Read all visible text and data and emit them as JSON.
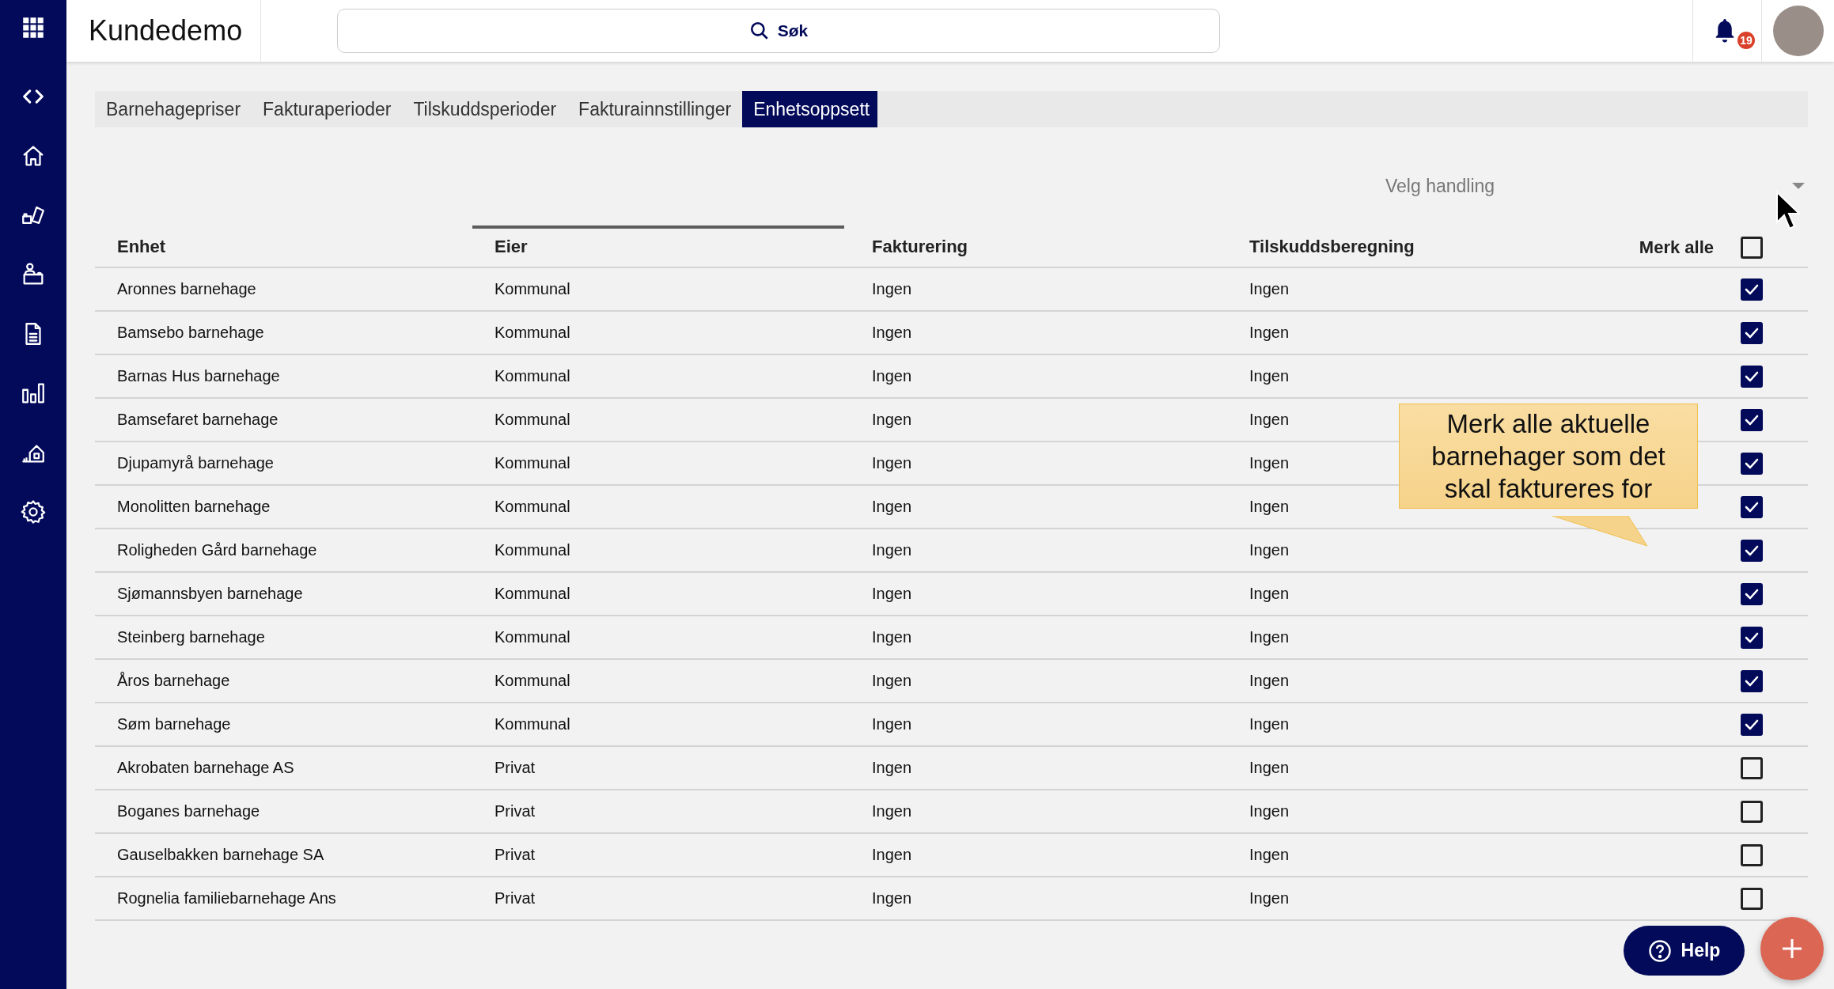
{
  "topbar": {
    "title": "Kundedemo",
    "search": {
      "placeholder": "Søk"
    },
    "notifications": {
      "count": "19"
    }
  },
  "tabs": [
    {
      "label": "Barnehagepriser",
      "selected": false
    },
    {
      "label": "Fakturaperioder",
      "selected": false
    },
    {
      "label": "Tilskuddsperioder",
      "selected": false
    },
    {
      "label": "Fakturainnstillinger",
      "selected": false
    },
    {
      "label": "Enhetsoppsett",
      "selected": true
    }
  ],
  "action_select": {
    "placeholder": "Velg handling"
  },
  "table": {
    "columns": [
      {
        "label": "Enhet",
        "sorted": false
      },
      {
        "label": "Eier",
        "sorted": true
      },
      {
        "label": "Fakturering",
        "sorted": false
      },
      {
        "label": "Tilskuddsberegning",
        "sorted": false
      }
    ],
    "select_all": {
      "label": "Merk alle",
      "checked": false
    },
    "rows": [
      {
        "unit": "Aronnes barnehage",
        "owner": "Kommunal",
        "invoicing": "Ingen",
        "subsidy": "Ingen",
        "checked": true
      },
      {
        "unit": "Bamsebo barnehage",
        "owner": "Kommunal",
        "invoicing": "Ingen",
        "subsidy": "Ingen",
        "checked": true
      },
      {
        "unit": "Barnas Hus barnehage",
        "owner": "Kommunal",
        "invoicing": "Ingen",
        "subsidy": "Ingen",
        "checked": true
      },
      {
        "unit": "Bamsefaret barnehage",
        "owner": "Kommunal",
        "invoicing": "Ingen",
        "subsidy": "Ingen",
        "checked": true
      },
      {
        "unit": "Djupamyrå barnehage",
        "owner": "Kommunal",
        "invoicing": "Ingen",
        "subsidy": "Ingen",
        "checked": true
      },
      {
        "unit": "Monolitten barnehage",
        "owner": "Kommunal",
        "invoicing": "Ingen",
        "subsidy": "Ingen",
        "checked": true
      },
      {
        "unit": "Roligheden Gård barnehage",
        "owner": "Kommunal",
        "invoicing": "Ingen",
        "subsidy": "Ingen",
        "checked": true
      },
      {
        "unit": "Sjømannsbyen barnehage",
        "owner": "Kommunal",
        "invoicing": "Ingen",
        "subsidy": "Ingen",
        "checked": true
      },
      {
        "unit": "Steinberg barnehage",
        "owner": "Kommunal",
        "invoicing": "Ingen",
        "subsidy": "Ingen",
        "checked": true
      },
      {
        "unit": "Åros barnehage",
        "owner": "Kommunal",
        "invoicing": "Ingen",
        "subsidy": "Ingen",
        "checked": true
      },
      {
        "unit": "Søm barnehage",
        "owner": "Kommunal",
        "invoicing": "Ingen",
        "subsidy": "Ingen",
        "checked": true
      },
      {
        "unit": "Akrobaten barnehage AS",
        "owner": "Privat",
        "invoicing": "Ingen",
        "subsidy": "Ingen",
        "checked": false
      },
      {
        "unit": "Boganes barnehage",
        "owner": "Privat",
        "invoicing": "Ingen",
        "subsidy": "Ingen",
        "checked": false
      },
      {
        "unit": "Gauselbakken barnehage SA",
        "owner": "Privat",
        "invoicing": "Ingen",
        "subsidy": "Ingen",
        "checked": false
      },
      {
        "unit": "Rognelia familiebarnehage Ans",
        "owner": "Privat",
        "invoicing": "Ingen",
        "subsidy": "Ingen",
        "checked": false
      }
    ]
  },
  "callout": {
    "text": "Merk alle aktuelle barnehager som det skal faktureres for"
  },
  "help_button": {
    "label": "Help"
  }
}
